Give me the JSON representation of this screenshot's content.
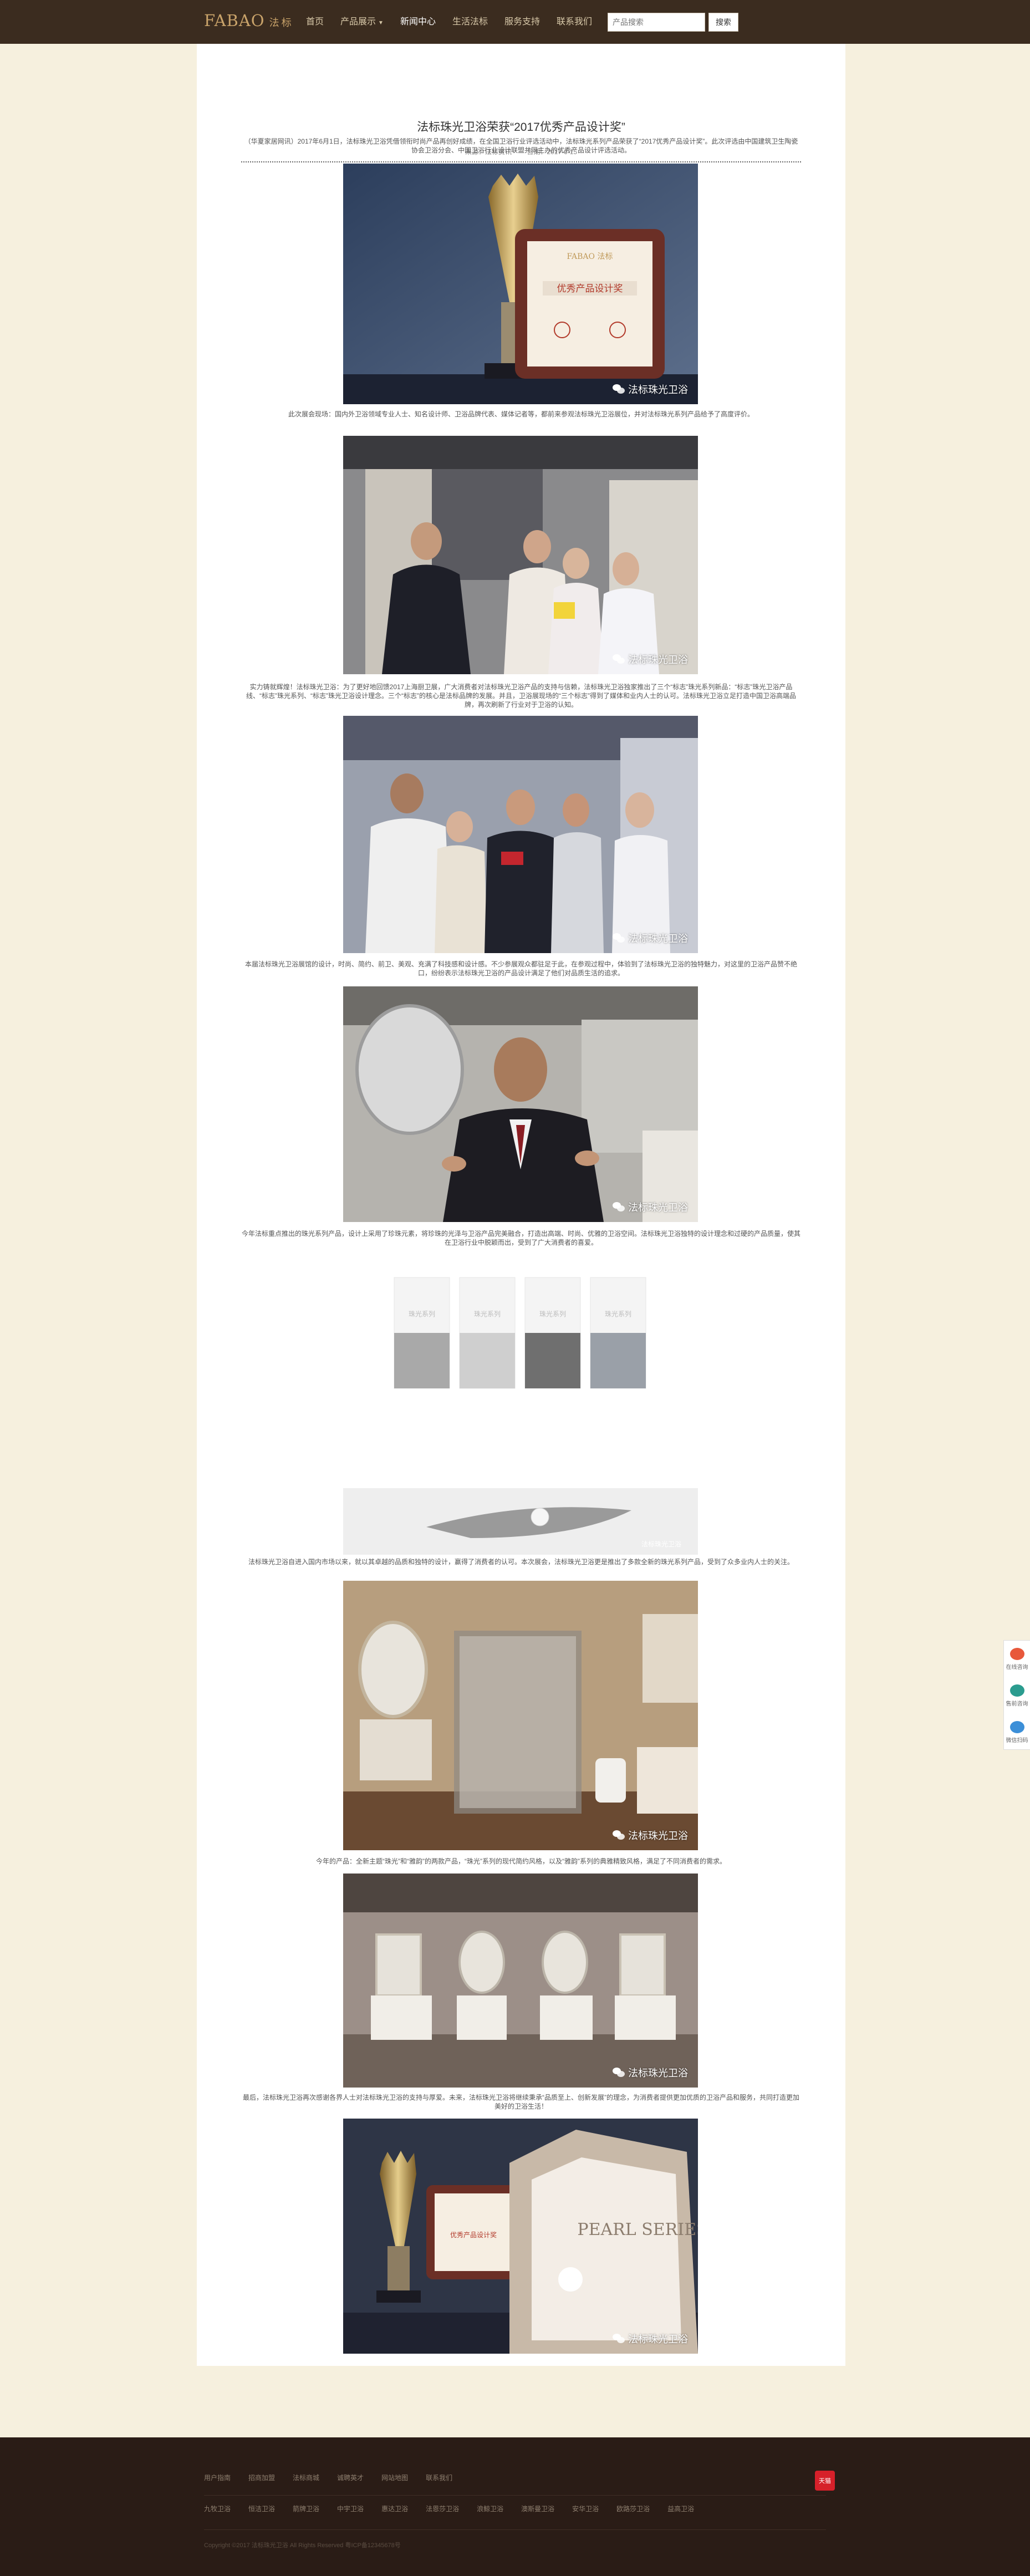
{
  "header": {
    "logo_en": "FABAO",
    "logo_cn": "法标",
    "nav": [
      "首页",
      "产品展示",
      "新闻中心",
      "生活法标",
      "服务支持",
      "联系我们"
    ],
    "active_nav": "新闻中心",
    "search_placeholder": "产品搜索",
    "search_button": "搜索"
  },
  "article": {
    "title": "法标珠光卫浴荣获“2017优秀产品设计奖”",
    "source_label": "来源：法标资讯",
    "date_label": "日期：2017-6-15",
    "paragraphs": [
      "（华夏家居网讯）2017年6月1日，法标珠光卫浴凭借领衔时尚产品再创好成绩，在全国卫浴行业评选活动中，法标珠光系列产品荣获了“2017优秀产品设计奖”。此次评选由中国建筑卫生陶瓷协会卫浴分会、中国卫浴行业设计联盟共同主办的优秀产品设计评选活动。",
      "此次展会现场：国内外卫浴领域专业人士、知名设计师、卫浴品牌代表、媒体记者等，都前来参观法标珠光卫浴展位，并对法标珠光系列产品给予了高度评价。",
      "实力铸就辉煌！法标珠光卫浴：为了更好地回馈2017上海厨卫展，广大消费者对法标珠光卫浴产品的支持与信赖，法标珠光卫浴独家推出了三个“标志”珠光系列新品：“标志”珠光卫浴产品线、“标志”珠光系列、“标志”珠光卫浴设计理念。三个“标志”的核心是法标品牌的发展。并且，卫浴展现场的“三个标志”得到了媒体和业内人士的认可。法标珠光卫浴立足打造中国卫浴高端品牌，再次刷新了行业对于卫浴的认知。",
      "本届法标珠光卫浴展馆的设计，时尚、简约、前卫、美观、充满了科技感和设计感。不少参展观众都驻足于此，在参观过程中，体验到了法标珠光卫浴的独特魅力，对这里的卫浴产品赞不绝口，纷纷表示法标珠光卫浴的产品设计满足了他们对品质生活的追求。",
      "今年法标重点推出的珠光系列产品，设计上采用了珍珠元素，将珍珠的光泽与卫浴产品完美融合，打造出高端、时尚、优雅的卫浴空间。法标珠光卫浴独特的设计理念和过硬的产品质量，使其在卫浴行业中脱颖而出，受到了广大消费者的喜爱。",
      "法标珠光卫浴自进入国内市场以来，就以其卓越的品质和独特的设计，赢得了消费者的认可。本次展会，法标珠光卫浴更是推出了多款全新的珠光系列产品，受到了众多业内人士的关注。",
      "今年的产品：全新主题“珠光”和“雅韵”的两款产品，“珠光”系列的现代简约风格，以及“雅韵”系列的典雅精致风格，满足了不同消费者的需求。",
      "最后，法标珠光卫浴再次感谢各界人士对法标珠光卫浴的支持与厚爱。未来，法标珠光卫浴将继续秉承“品质至上、创新发展”的理念，为消费者提供更加优质的卫浴产品和服务，共同打造更加美好的卫浴生活！"
    ],
    "photo_caption": "法标珠光卫浴",
    "pearl_labels": [
      "珠光系列",
      "珠光系列",
      "珠光系列",
      "珠光系列"
    ],
    "pearl_caption": "法标珠光卫浴",
    "award_text": "优秀产品设计奖",
    "award_brand": "FABAO 法标",
    "pearl_series_text": "PEARL SERIES"
  },
  "side_widget": [
    "在线咨询",
    "售前咨询",
    "微信扫码"
  ],
  "footer": {
    "row1": [
      "用户指南",
      "招商加盟",
      "法标商城",
      "诚聘英才",
      "网站地图",
      "联系我们"
    ],
    "row2": [
      "九牧卫浴",
      "恒洁卫浴",
      "箭牌卫浴",
      "中宇卫浴",
      "惠达卫浴",
      "法恩莎卫浴",
      "浪鲸卫浴",
      "澳斯曼卫浴",
      "安华卫浴",
      "欧路莎卫浴",
      "益高卫浴"
    ],
    "copyright": "Copyright ©2017 法标珠光卫浴 All Rights Reserved   粤ICP备12345678号",
    "tmall_label": "天猫"
  },
  "colors": {
    "header_bg": "#3b2c1f",
    "page_bg": "#f6f0de",
    "footer_bg": "#2a1c16",
    "accent": "#c9a36a"
  }
}
